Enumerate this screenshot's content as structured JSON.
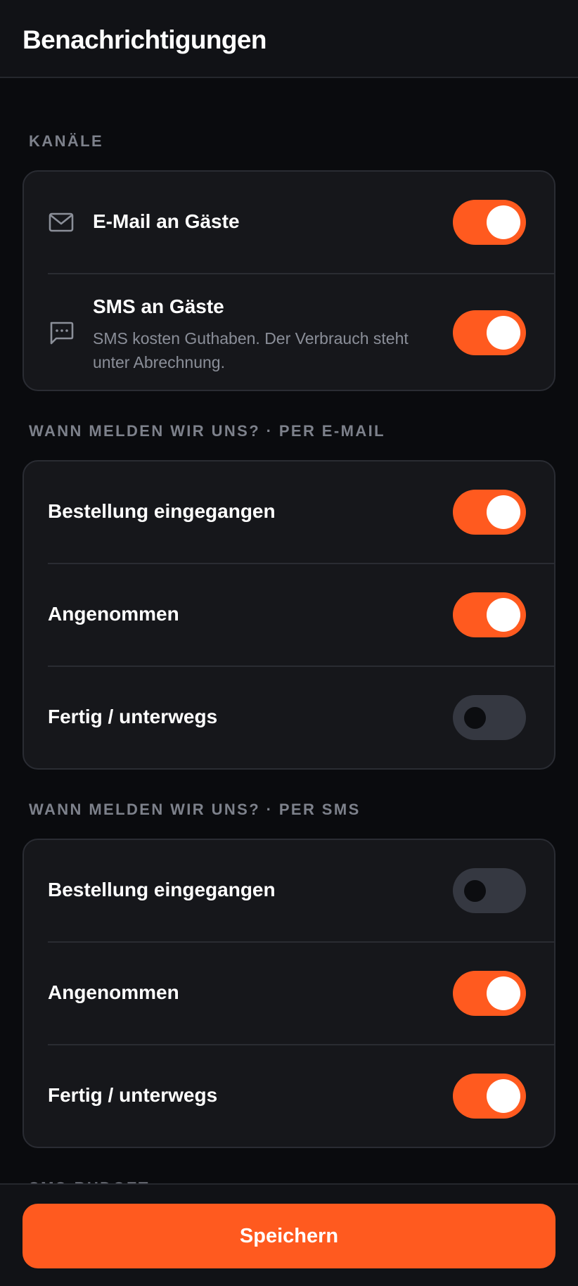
{
  "header": {
    "title": "Benachrichtigungen"
  },
  "channels": {
    "label": "Kanäle",
    "email": {
      "title": "E-Mail an Gäste",
      "icon": "mail-icon",
      "enabled": true
    },
    "sms": {
      "title": "SMS an Gäste",
      "subtitle_line1": "SMS kosten Guthaben. Der Verbrauch steht",
      "subtitle_line2": "unter Abrechnung.",
      "icon": "message-icon",
      "enabled": true
    }
  },
  "email_events": {
    "label": "Wann melden wir uns? · per E-Mail",
    "items": [
      {
        "title": "Bestellung eingegangen",
        "enabled": true
      },
      {
        "title": "Angenommen",
        "enabled": true
      },
      {
        "title": "Fertig / unterwegs",
        "enabled": false
      }
    ]
  },
  "sms_events": {
    "label": "Wann melden wir uns? · per SMS",
    "items": [
      {
        "title": "Bestellung eingegangen",
        "enabled": false
      },
      {
        "title": "Angenommen",
        "enabled": true
      },
      {
        "title": "Fertig / unterwegs",
        "enabled": true
      }
    ]
  },
  "sms_budget": {
    "label": "SMS-BUDGET"
  },
  "footer": {
    "save_label": "Speichern"
  },
  "colors": {
    "accent": "#ff5a1f",
    "toggle_off": "#353841",
    "background": "#0a0b0e",
    "card": "#16171b"
  }
}
